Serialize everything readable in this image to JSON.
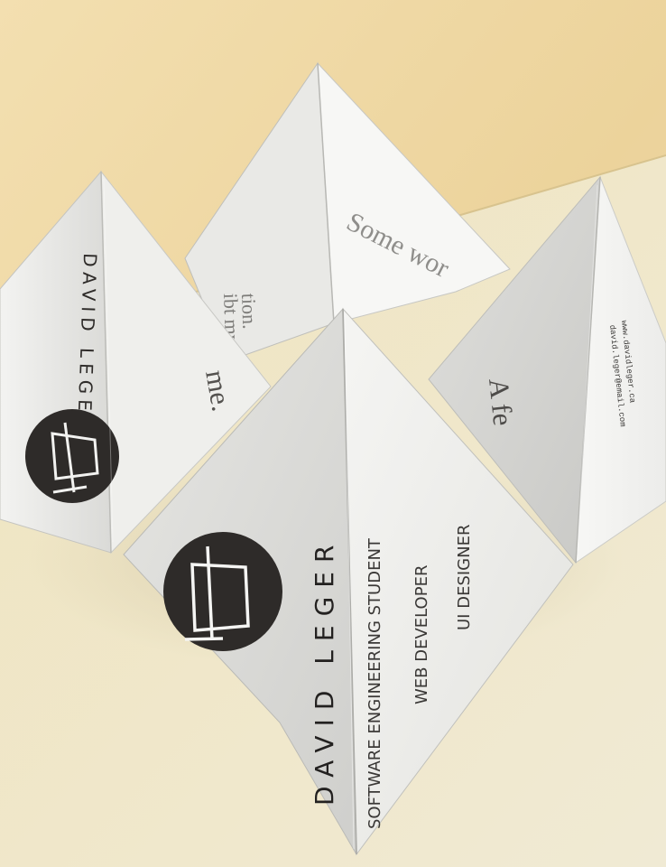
{
  "photo": {
    "front_panel": {
      "name": "DAVID LEGER",
      "lines": [
        "SOFTWARE ENGINEERING STUDENT",
        "WEB DEVELOPER",
        "UI DESIGNER"
      ]
    },
    "left_panel": {
      "name": "DAVID LEGER",
      "fragment": "me."
    },
    "back_panel": {
      "heading": "Some wor",
      "line_1": "ibt my",
      "line_2": "tion."
    },
    "right_panel": {
      "fragment": "A fe",
      "contact_1": "www.davidleger.ca",
      "contact_2": "david.leger@email.com"
    },
    "colors": {
      "wall": "#f0d9a6",
      "table": "#efe7c9",
      "paper": "#f4f4f2",
      "ink": "#2e2b29"
    }
  }
}
